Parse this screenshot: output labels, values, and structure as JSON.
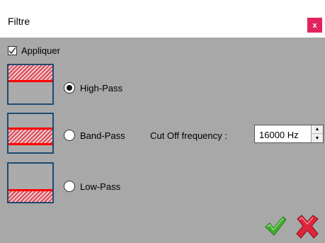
{
  "window": {
    "title": "Filtre",
    "close_label": "x"
  },
  "apply": {
    "label": "Appliquer",
    "checked": true
  },
  "filters": [
    {
      "label": "High-Pass",
      "selected": true,
      "icon": "high-pass-filter-icon"
    },
    {
      "label": "Band-Pass",
      "selected": false,
      "icon": "band-pass-filter-icon"
    },
    {
      "label": "Low-Pass",
      "selected": false,
      "icon": "low-pass-filter-icon"
    }
  ],
  "cutoff": {
    "label": "Cut Off frequency :",
    "value": "16000 Hz"
  },
  "actions": {
    "ok_icon": "green-checkmark-icon",
    "cancel_icon": "red-x-icon"
  },
  "colors": {
    "background": "#a8a8a8",
    "close_button": "#e0245e",
    "frame": "#1d4c73",
    "filter_line": "#ff0000",
    "ok": "#3fb02b",
    "cancel": "#e0243c"
  }
}
